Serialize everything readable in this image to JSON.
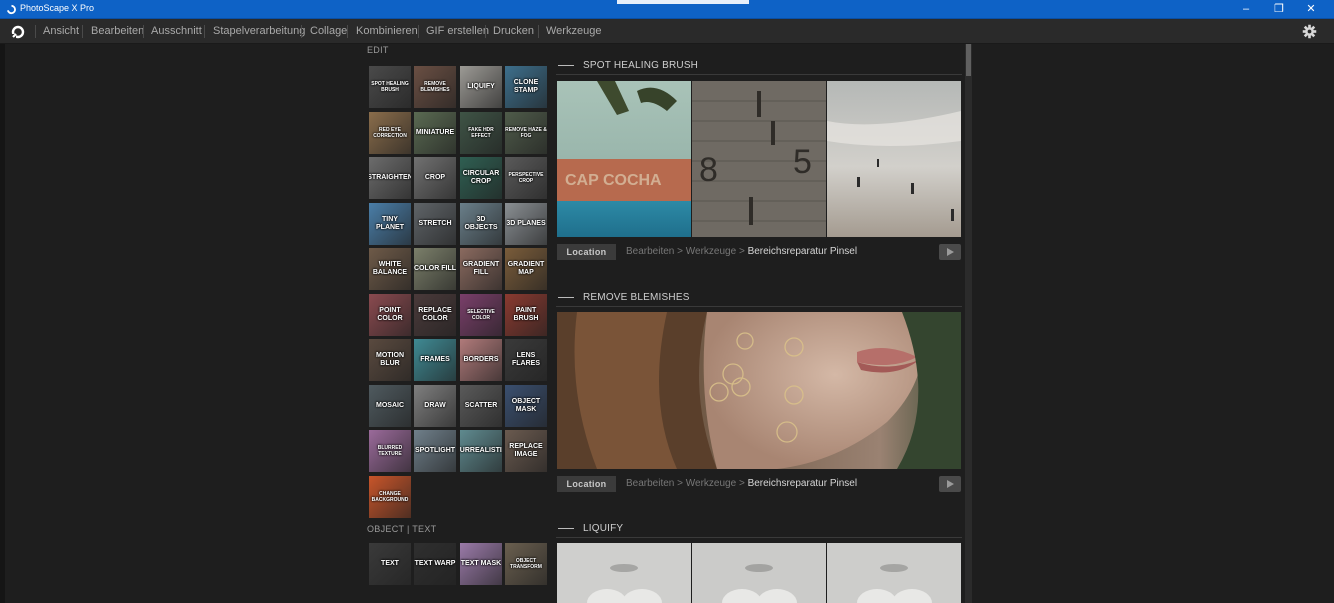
{
  "window": {
    "title": "PhotoScape X Pro",
    "controls": {
      "minimize": "–",
      "restore": "❐",
      "close": "✕"
    }
  },
  "menu": {
    "items": [
      "Ansicht",
      "Bearbeiten",
      "Ausschnitt",
      "Stapelverarbeitung",
      "Collage",
      "Kombinieren",
      "GIF erstellen",
      "Drucken",
      "Werkzeuge"
    ]
  },
  "edit_section": {
    "label": "EDIT",
    "tiles": [
      {
        "label": "SPOT HEALING BRUSH",
        "color": "#4a4a4a"
      },
      {
        "label": "REMOVE BLEMISHES",
        "color": "#6a4f43"
      },
      {
        "label": "LIQUIFY",
        "color": "#9c9a95"
      },
      {
        "label": "CLONE STAMP",
        "color": "#3d6f8c"
      },
      {
        "label": "RED EYE CORRECTION",
        "color": "#8a6d4b"
      },
      {
        "label": "MINIATURE",
        "color": "#5a6a52"
      },
      {
        "label": "FAKE HDR EFFECT",
        "color": "#3f5446"
      },
      {
        "label": "REMOVE HAZE & FOG",
        "color": "#4f5b4a"
      },
      {
        "label": "STRAIGHTEN",
        "color": "#6c6c6c"
      },
      {
        "label": "CROP",
        "color": "#717171"
      },
      {
        "label": "CIRCULAR CROP",
        "color": "#2f5f52"
      },
      {
        "label": "PERSPECTIVE CROP",
        "color": "#5a5a5a"
      },
      {
        "label": "TINY PLANET",
        "color": "#4a7ea8"
      },
      {
        "label": "STRETCH",
        "color": "#5f6468"
      },
      {
        "label": "3D OBJECTS",
        "color": "#6a7f8a"
      },
      {
        "label": "3D PLANES",
        "color": "#8a8f93"
      },
      {
        "label": "WHITE BALANCE",
        "color": "#6e5a48"
      },
      {
        "label": "COLOR FILL",
        "color": "#7b7f6a"
      },
      {
        "label": "GRADIENT FILL",
        "color": "#8a6a5f"
      },
      {
        "label": "GRADIENT MAP",
        "color": "#7a5c3a"
      },
      {
        "label": "POINT COLOR",
        "color": "#8a4a4f"
      },
      {
        "label": "REPLACE COLOR",
        "color": "#4a3a3a"
      },
      {
        "label": "SELECTIVE COLOR",
        "color": "#7a3f6a"
      },
      {
        "label": "PAINT BRUSH",
        "color": "#8a3a30"
      },
      {
        "label": "MOTION BLUR",
        "color": "#5a4a3f"
      },
      {
        "label": "FRAMES",
        "color": "#3f8a94"
      },
      {
        "label": "BORDERS",
        "color": "#b07a7a"
      },
      {
        "label": "LENS FLARES",
        "color": "#3a3a3a"
      },
      {
        "label": "MOSAIC",
        "color": "#4f5a5f"
      },
      {
        "label": "DRAW",
        "color": "#7f7f7f"
      },
      {
        "label": "SCATTER",
        "color": "#5a5a5a"
      },
      {
        "label": "OBJECT MASK",
        "color": "#3a4f6f"
      },
      {
        "label": "BLURRED TEXTURE",
        "color": "#9a6a9a"
      },
      {
        "label": "SPOTLIGHT",
        "color": "#6f7f8a"
      },
      {
        "label": "SURREALISTIC",
        "color": "#5f8a8f"
      },
      {
        "label": "REPLACE IMAGE",
        "color": "#6a5a4f"
      },
      {
        "label": "CHANGE BACKGROUND",
        "color": "#c8552a"
      }
    ]
  },
  "object_section": {
    "label": "OBJECT | TEXT",
    "tiles": [
      {
        "label": "TEXT",
        "color": "#3a3a3a"
      },
      {
        "label": "TEXT WARP",
        "color": "#2f2f2f"
      },
      {
        "label": "TEXT MASK",
        "color": "#9a7aa8"
      },
      {
        "label": "OBJECT TRANSFORM",
        "color": "#6a5f4f"
      }
    ]
  },
  "content": {
    "sections": [
      {
        "title": "SPOT HEALING BRUSH",
        "location_label": "Location",
        "path_prefix": "Bearbeiten > Werkzeuge > ",
        "path_current": "Bereichsreparatur Pinsel"
      },
      {
        "title": "REMOVE BLEMISHES",
        "location_label": "Location",
        "path_prefix": "Bearbeiten > Werkzeuge > ",
        "path_current": "Bereichsreparatur Pinsel"
      },
      {
        "title": "LIQUIFY"
      }
    ]
  }
}
